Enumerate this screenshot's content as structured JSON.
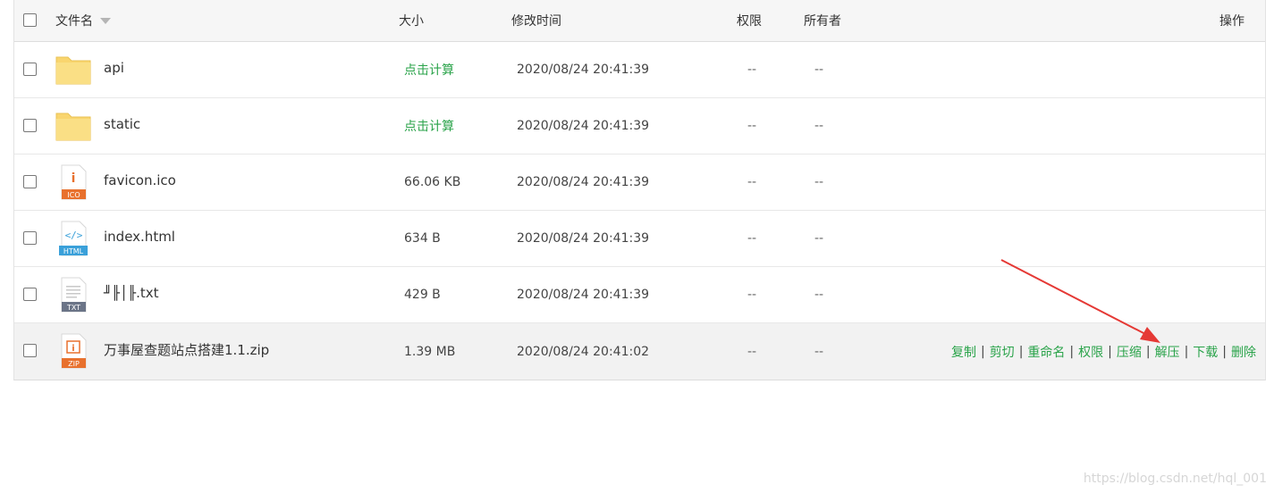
{
  "header": {
    "name": "文件名",
    "size": "大小",
    "mtime": "修改时间",
    "perm": "权限",
    "owner": "所有者",
    "ops": "操作"
  },
  "files": [
    {
      "name": "api",
      "icon": "folder-icon",
      "size": "点击计算",
      "mtime": "2020/08/24 20:41:39",
      "perm": "--",
      "owner": "--"
    },
    {
      "name": "static",
      "icon": "folder-icon",
      "size": "点击计算",
      "mtime": "2020/08/24 20:41:39",
      "perm": "--",
      "owner": "--"
    },
    {
      "name": "favicon.ico",
      "icon": "ico-file-icon",
      "icon_label": "ICO",
      "size": "66.06 KB",
      "mtime": "2020/08/24 20:41:39",
      "perm": "--",
      "owner": "--"
    },
    {
      "name": "index.html",
      "icon": "html-file-icon",
      "icon_label": "HTML",
      "size": "634 B",
      "mtime": "2020/08/24 20:41:39",
      "perm": "--",
      "owner": "--"
    },
    {
      "name": "╜╟│╟.txt",
      "icon": "txt-file-icon",
      "icon_label": "TXT",
      "size": "429 B",
      "mtime": "2020/08/24 20:41:39",
      "perm": "--",
      "owner": "--"
    },
    {
      "name": "万事屋查题站点搭建1.1.zip",
      "icon": "zip-file-icon",
      "icon_label": "ZIP",
      "size": "1.39 MB",
      "mtime": "2020/08/24 20:41:02",
      "perm": "--",
      "owner": "--"
    }
  ],
  "actions": [
    "复制",
    "剪切",
    "重命名",
    "权限",
    "压缩",
    "解压",
    "下载",
    "删除"
  ],
  "watermark": "https://blog.csdn.net/hql_001",
  "colors": {
    "accent": "#2aa34a",
    "arrow": "#e53935",
    "folder": "#f9d56e",
    "ico": "#e8712e",
    "html": "#3aa0d9",
    "txt": "#6b7487",
    "zip": "#e8712e"
  }
}
